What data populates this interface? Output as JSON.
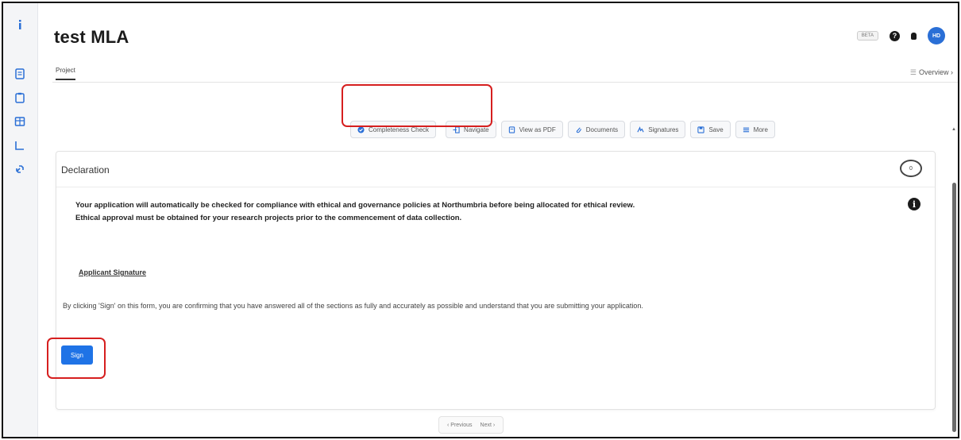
{
  "sidebar": {
    "icons": [
      "info-icon",
      "document-icon",
      "clipboard-icon",
      "table-icon",
      "chart-icon",
      "link-icon"
    ]
  },
  "header": {
    "title": "test MLA",
    "beta_badge": "BETA",
    "help_glyph": "?",
    "avatar_initials": "HD"
  },
  "tabs": {
    "project": "Project",
    "overview": "Overview",
    "overview_glyph": "☰",
    "overview_chevron": "›"
  },
  "toolbar": {
    "completeness": "Completeness Check",
    "navigate": "Navigate",
    "view_pdf": "View as PDF",
    "documents": "Documents",
    "signatures": "Signatures",
    "save": "Save",
    "more": "More"
  },
  "declaration": {
    "title": "Declaration",
    "comment_count": "0",
    "info_glyph": "i",
    "notice_line1": "Your application will automatically be checked for compliance with ethical and governance policies at Northumbria before being allocated for ethical review.",
    "notice_line2": "Ethical approval must be obtained for your research projects prior to the commencement of data collection.",
    "signature_heading": "Applicant Signature",
    "confirm_text": "By clicking 'Sign' on this form, you are confirming that you have answered all of the sections as fully and accurately as possible and understand that you are submitting your application.",
    "sign_button": "Sign"
  },
  "pager": {
    "previous": "‹ Previous",
    "next": "Next ›"
  },
  "colors": {
    "accent": "#1f73e6",
    "highlight": "#d61f1f",
    "avatar": "#2a6fd6"
  }
}
